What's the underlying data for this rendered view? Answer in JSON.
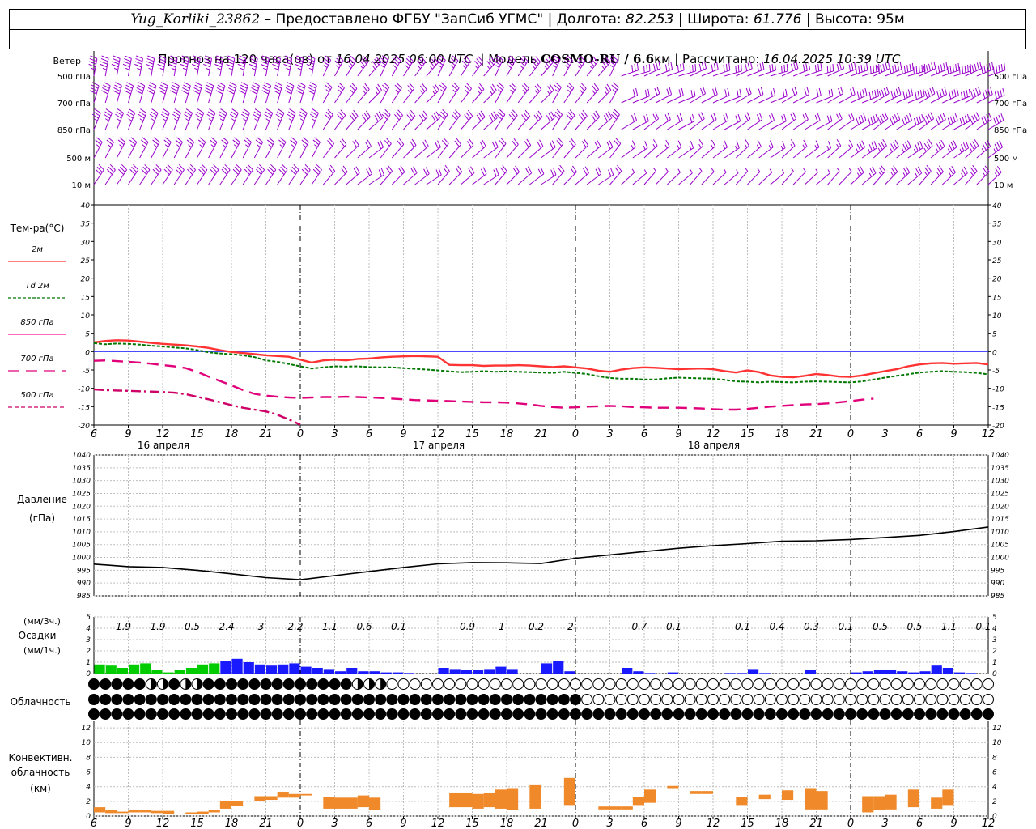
{
  "header": {
    "row1": [
      {
        "text": "Yug_Korliki_23862",
        "style": "italic"
      },
      {
        "text": " – Предоставлено ФГБУ \"ЗапСиб УГМС\" | Долгота: ",
        "style": "normal"
      },
      {
        "text": "82.253",
        "style": "italic"
      },
      {
        "text": " | Широта: ",
        "style": "normal"
      },
      {
        "text": "61.776",
        "style": "italic"
      },
      {
        "text": " | Высота: 95м",
        "style": "normal"
      }
    ],
    "row2": [
      {
        "text": "Прогноз на 120 часа(ов) от ",
        "style": "normal"
      },
      {
        "text": "16.04.2025 06:00 UTC",
        "style": "italic"
      },
      {
        "text": "  | Модель ",
        "style": "normal"
      },
      {
        "text": "COSMO-RU / 6.6",
        "style": "bold"
      },
      {
        "text": "км | Рассчитано: ",
        "style": "normal"
      },
      {
        "text": "16.04.2025 10:39 UTC",
        "style": "italic"
      }
    ]
  },
  "colors": {
    "wind": "#9900cc",
    "t2m": "#ff3333",
    "td2m": "#007700",
    "t850": "#ff1493",
    "t700": "#e0007a",
    "t500": "#cc0066",
    "pressure": "#000000",
    "precip_conv": "#00cc00",
    "precip_strat": "#1a1aff",
    "conv_cloud": "#f0892a",
    "zero_line": "#3333ff"
  },
  "time_axis": {
    "ticks": [
      "6",
      "9",
      "12",
      "15",
      "18",
      "21",
      "0",
      "3",
      "6",
      "9",
      "12",
      "15",
      "18",
      "21",
      "0",
      "3",
      "6",
      "9",
      "12",
      "15",
      "18",
      "21",
      "0",
      "3",
      "6",
      "9",
      "12"
    ],
    "dates": [
      "16 апреля",
      "17 апреля",
      "18 апреля"
    ]
  },
  "wind": {
    "title": "Ветер",
    "levels": [
      "500 гПа",
      "700 гПа",
      "850 гПа",
      "500 м",
      "10  м"
    ]
  },
  "temperature": {
    "title": "Тем-ра(°С)",
    "ylim": [
      -20,
      40
    ],
    "yticks": [
      "40",
      "35",
      "30",
      "25",
      "20",
      "15",
      "10",
      "5",
      "0",
      "-5",
      "-10",
      "-15",
      "-20"
    ],
    "legend": [
      {
        "label": "2м",
        "key": "t2m",
        "dash": ""
      },
      {
        "label": "Td  2м",
        "key": "td2m",
        "dash": "4,2"
      },
      {
        "label": "850 гПа",
        "key": "t850",
        "dash": ""
      },
      {
        "label": "700 гПа",
        "key": "t700",
        "dash": "14,8"
      },
      {
        "label": "500 гПа",
        "key": "t500",
        "dash": "5,3"
      }
    ]
  },
  "pressure": {
    "title1": "Давление",
    "title2": "(гПа)",
    "ylim": [
      985,
      1040
    ],
    "yticks": [
      "1040",
      "1035",
      "1030",
      "1025",
      "1020",
      "1015",
      "1010",
      "1005",
      "1000",
      "995",
      "990",
      "985"
    ]
  },
  "precip": {
    "unit1": "(мм/3ч.)",
    "title": "Осадки",
    "unit2": "(мм/1ч.)",
    "yticks": [
      "5",
      "4",
      "3",
      "2",
      "1",
      "0"
    ],
    "sums": [
      {
        "h": 3,
        "v": "1.9"
      },
      {
        "h": 6,
        "v": "1.9"
      },
      {
        "h": 9,
        "v": "0.5"
      },
      {
        "h": 12,
        "v": "2.4"
      },
      {
        "h": 15,
        "v": "3"
      },
      {
        "h": 18,
        "v": "2.2"
      },
      {
        "h": 21,
        "v": "1.1"
      },
      {
        "h": 24,
        "v": "0.6"
      },
      {
        "h": 27,
        "v": "0.1"
      },
      {
        "h": 33,
        "v": "0.9"
      },
      {
        "h": 36,
        "v": "1"
      },
      {
        "h": 39,
        "v": "0.2"
      },
      {
        "h": 42,
        "v": "2"
      },
      {
        "h": 48,
        "v": "0.7"
      },
      {
        "h": 51,
        "v": "0.1"
      },
      {
        "h": 57,
        "v": "0.1"
      },
      {
        "h": 60,
        "v": "0.4"
      },
      {
        "h": 63,
        "v": "0.3"
      },
      {
        "h": 66,
        "v": "0.1"
      },
      {
        "h": 69,
        "v": "0.5"
      },
      {
        "h": 72,
        "v": "0.5"
      },
      {
        "h": 75,
        "v": "1.1"
      },
      {
        "h": 78,
        "v": "0.1"
      }
    ]
  },
  "clouds": {
    "title": "Облачность"
  },
  "conv": {
    "title1": "Конвективн.",
    "title2": "облачность",
    "title3": "(км)",
    "ylim": [
      0,
      13
    ],
    "yticks": [
      "12",
      "10",
      "8",
      "6",
      "4",
      "2",
      "0"
    ]
  },
  "chart_data": [
    {
      "type": "line",
      "title": "Тем-ра(°С)",
      "x_hours_from_start": [
        0,
        1,
        2,
        3,
        4,
        5,
        6,
        7,
        8,
        9,
        10,
        11,
        12,
        13,
        14,
        15,
        16,
        17,
        18,
        19,
        20,
        21,
        22,
        23,
        24,
        25,
        26,
        27,
        28,
        29,
        30,
        31,
        32,
        33,
        34,
        35,
        36,
        37,
        38,
        39,
        40,
        41,
        42,
        43,
        44,
        45,
        46,
        47,
        48,
        49,
        50,
        51,
        52,
        53,
        54,
        55,
        56,
        57,
        58,
        59,
        60,
        61,
        62,
        63,
        64,
        65,
        66,
        67,
        68,
        69,
        70,
        71,
        72,
        73,
        74,
        75,
        76,
        77,
        78
      ],
      "ylim": [
        -20,
        40
      ],
      "series": [
        {
          "name": "2м",
          "key": "t2m",
          "values": [
            2.5,
            2.9,
            3.1,
            3.0,
            2.7,
            2.4,
            2.1,
            1.9,
            1.7,
            1.4,
            1.0,
            0.4,
            -0.1,
            -0.4,
            -0.7,
            -1.0,
            -1.2,
            -1.4,
            -2.2,
            -3.0,
            -2.4,
            -2.2,
            -2.4,
            -2.0,
            -1.9,
            -1.6,
            -1.4,
            -1.3,
            -1.2,
            -1.3,
            -1.4,
            -3.6,
            -3.7,
            -3.7,
            -3.9,
            -3.8,
            -3.8,
            -3.7,
            -3.8,
            -4.0,
            -4.2,
            -4.0,
            -4.3,
            -4.6,
            -5.2,
            -5.5,
            -4.9,
            -4.5,
            -4.3,
            -4.4,
            -4.6,
            -4.8,
            -4.7,
            -4.6,
            -4.8,
            -5.3,
            -5.7,
            -5.1,
            -5.6,
            -6.5,
            -6.9,
            -7.0,
            -6.6,
            -6.1,
            -6.4,
            -6.8,
            -6.9,
            -6.5,
            -5.9,
            -5.3,
            -4.8,
            -4.0,
            -3.5,
            -3.2,
            -3.1,
            -3.3,
            -3.2,
            -3.1,
            -3.5
          ]
        },
        {
          "name": "Td 2м",
          "key": "td2m",
          "values": [
            2.3,
            2.0,
            2.2,
            2.1,
            1.9,
            1.6,
            1.4,
            1.1,
            0.9,
            0.4,
            -0.2,
            -0.5,
            -0.7,
            -1.0,
            -1.5,
            -2.4,
            -2.8,
            -3.4,
            -4.0,
            -4.6,
            -4.3,
            -4.0,
            -4.1,
            -4.0,
            -4.2,
            -4.3,
            -4.3,
            -4.5,
            -4.7,
            -4.9,
            -5.1,
            -5.4,
            -5.6,
            -5.5,
            -5.3,
            -5.5,
            -5.4,
            -5.5,
            -5.6,
            -5.7,
            -5.8,
            -5.5,
            -5.8,
            -6.1,
            -6.7,
            -7.2,
            -7.4,
            -7.4,
            -7.6,
            -7.6,
            -7.3,
            -7.1,
            -7.2,
            -7.3,
            -7.4,
            -7.7,
            -8.1,
            -8.2,
            -8.4,
            -8.2,
            -8.3,
            -8.4,
            -8.2,
            -8.1,
            -8.2,
            -8.3,
            -8.4,
            -8.1,
            -7.6,
            -7.1,
            -6.6,
            -6.2,
            -5.7,
            -5.5,
            -5.3,
            -5.5,
            -5.6,
            -5.8,
            -6.2
          ]
        },
        {
          "name": "850 гПа",
          "key": "t850",
          "values": [
            null
          ]
        },
        {
          "name": "700 гПа",
          "key": "t700",
          "values": [
            -2.5,
            -2.4,
            -2.6,
            -2.8,
            -3.0,
            -3.3,
            -3.7,
            -4.0,
            -4.5,
            -5.5,
            -6.8,
            -8.0,
            -9.2,
            -10.5,
            -11.5,
            -12.0,
            -12.3,
            -12.5,
            -12.6,
            -12.5,
            -12.4,
            -12.4,
            -12.3,
            -12.4,
            -12.5,
            -12.6,
            -12.8,
            -13.0,
            -13.2,
            -13.3,
            -13.4,
            -13.5,
            -13.6,
            -13.7,
            -13.8,
            -13.8,
            -13.9,
            -14.1,
            -14.4,
            -14.8,
            -15.1,
            -15.3,
            -15.2,
            -15.0,
            -14.9,
            -14.8,
            -14.9,
            -15.1,
            -15.2,
            -15.3,
            -15.3,
            -15.3,
            -15.4,
            -15.5,
            -15.7,
            -15.8,
            -15.8,
            -15.6,
            -15.3,
            -15.0,
            -14.8,
            -14.6,
            -14.4,
            -14.3,
            -14.1,
            -13.8,
            -13.5,
            -13.1,
            -12.8
          ]
        },
        {
          "name": "500 гПа",
          "key": "t500",
          "values": [
            -10.3,
            -10.5,
            -10.6,
            -10.7,
            -10.8,
            -10.9,
            -11.0,
            -11.2,
            -11.6,
            -12.3,
            -13.0,
            -13.8,
            -14.6,
            -15.3,
            -15.8,
            -16.3,
            -17.2,
            -18.5,
            -19.9,
            -21.0
          ]
        }
      ]
    },
    {
      "type": "line",
      "title": "Давление",
      "ylabel": "(гПа)",
      "ylim": [
        985,
        1040
      ],
      "x_hours_from_start": [
        0,
        3,
        6,
        9,
        12,
        15,
        18,
        21,
        24,
        27,
        30,
        33,
        36,
        39,
        42,
        45,
        48,
        51,
        54,
        57,
        60,
        63,
        66,
        69,
        72,
        75,
        78
      ],
      "series": [
        {
          "name": "Давление",
          "values": [
            997.4,
            996.4,
            996.1,
            995.0,
            993.6,
            992.1,
            991.3,
            992.9,
            994.5,
            996.1,
            997.5,
            998.0,
            997.9,
            997.6,
            999.7,
            1001.0,
            1002.3,
            1003.6,
            1004.6,
            1005.4,
            1006.3,
            1006.5,
            1007.0,
            1007.8,
            1008.6,
            1010.1,
            1011.9
          ]
        }
      ]
    },
    {
      "type": "bar",
      "title": "Осадки",
      "ylabel": "(мм/1ч.)",
      "ylim": [
        0,
        5
      ],
      "x_hours_from_start": [
        0,
        1,
        2,
        3,
        4,
        5,
        6,
        7,
        8,
        9,
        10,
        11,
        12,
        13,
        14,
        15,
        16,
        17,
        18,
        19,
        20,
        21,
        22,
        23,
        24,
        25,
        26,
        27,
        28,
        29,
        30,
        31,
        32,
        33,
        34,
        35,
        36,
        37,
        38,
        39,
        40,
        41,
        42,
        43,
        44,
        45,
        46,
        47,
        48,
        49,
        50,
        51,
        52,
        53,
        54,
        55,
        56,
        57,
        58,
        59,
        60,
        61,
        62,
        63,
        64,
        65,
        66,
        67,
        68,
        69,
        70,
        71,
        72,
        73,
        74,
        75,
        76,
        77,
        78
      ],
      "series": [
        {
          "name": "conv",
          "values": [
            0.8,
            0.7,
            0.5,
            0.8,
            0.9,
            0.3,
            0.1,
            0.3,
            0.5,
            0.8,
            0.9,
            0.0,
            0.0,
            0.0,
            0.0,
            0.0,
            0,
            0,
            0,
            0,
            0,
            0,
            0,
            0,
            0,
            0,
            0,
            0,
            0,
            0,
            0,
            0,
            0,
            0,
            0,
            0,
            0,
            0,
            0,
            0,
            0,
            0,
            0,
            0,
            0,
            0,
            0,
            0,
            0,
            0,
            0,
            0,
            0,
            0,
            0,
            0,
            0,
            0,
            0,
            0,
            0,
            0,
            0,
            0,
            0,
            0,
            0,
            0,
            0,
            0,
            0,
            0,
            0,
            0,
            0,
            0,
            0,
            0,
            0
          ]
        },
        {
          "name": "strat",
          "values": [
            0,
            0,
            0,
            0,
            0,
            0,
            0,
            0,
            0,
            0,
            0,
            1.1,
            1.3,
            1.0,
            0.8,
            0.7,
            0.8,
            0.9,
            0.6,
            0.5,
            0.4,
            0.2,
            0.5,
            0.2,
            0.2,
            0.1,
            0.1,
            0.05,
            0,
            0,
            0.5,
            0.4,
            0.3,
            0.3,
            0.4,
            0.6,
            0.4,
            0,
            0,
            0.9,
            1.1,
            0.2,
            0,
            0,
            0,
            0,
            0.5,
            0.2,
            0.05,
            0,
            0.1,
            0,
            0,
            0,
            0,
            0.05,
            0.05,
            0.4,
            0.05,
            0,
            0,
            0,
            0.3,
            0,
            0,
            0,
            0.1,
            0.2,
            0.3,
            0.3,
            0.2,
            0.1,
            0.2,
            0.7,
            0.5,
            0.1,
            0.05,
            0,
            0
          ]
        }
      ]
    },
    {
      "type": "bar",
      "title": "Конвективн. облачность",
      "ylabel": "(км)",
      "ylim": [
        0,
        13
      ],
      "x_hours_from_start": [
        0,
        1,
        2,
        3,
        4,
        5,
        6,
        7,
        8,
        9,
        10,
        11,
        12,
        13,
        14,
        15,
        16,
        17,
        18,
        19,
        20,
        21,
        22,
        23,
        24,
        25,
        26,
        27,
        28,
        29,
        30,
        31,
        32,
        33,
        34,
        35,
        36,
        37,
        38,
        39,
        40,
        41,
        42,
        43,
        44,
        45,
        46,
        47,
        48,
        49,
        50,
        51,
        52,
        53,
        54,
        55,
        56,
        57,
        58,
        59,
        60,
        61,
        62,
        63,
        64,
        65,
        66,
        67,
        68,
        69,
        70,
        71,
        72,
        73,
        74,
        75,
        76,
        77,
        78
      ],
      "series": [
        {
          "name": "base",
          "values": [
            0.5,
            0.4,
            0.4,
            0.5,
            0.5,
            0.4,
            0.3,
            0,
            0.3,
            0.3,
            0.5,
            1.0,
            1.4,
            0,
            2.0,
            2.2,
            2.5,
            2.5,
            2.8,
            0,
            1.0,
            1.0,
            1.0,
            1.2,
            0.8,
            0,
            0,
            0,
            0,
            0,
            0,
            1.2,
            1.2,
            1.0,
            1.2,
            1.0,
            0.8,
            0,
            1.0,
            0,
            0,
            1.5,
            0,
            0,
            0.9,
            0.9,
            0.9,
            1.5,
            1.8,
            0,
            3.8,
            0,
            3.0,
            3.0,
            0,
            0,
            1.5,
            0,
            2.3,
            0,
            2.2,
            0,
            0.9,
            0.9,
            0,
            0,
            0,
            0.5,
            0.8,
            0.9,
            0,
            1.2,
            0,
            1.0,
            1.5,
            0,
            0,
            0,
            0
          ]
        },
        {
          "name": "top",
          "values": [
            1.2,
            0.8,
            0.6,
            0.8,
            0.8,
            0.7,
            0.7,
            0,
            0.5,
            0.6,
            0.8,
            2.0,
            2.0,
            0,
            2.7,
            2.7,
            3.3,
            3.0,
            3.0,
            0,
            2.6,
            2.5,
            2.5,
            2.8,
            2.5,
            0,
            0,
            0,
            0,
            0,
            0,
            3.2,
            3.2,
            3.0,
            3.2,
            3.6,
            3.8,
            0,
            4.2,
            0,
            0,
            5.2,
            0,
            0,
            1.3,
            1.3,
            1.3,
            2.6,
            3.6,
            0,
            4.1,
            0,
            3.4,
            3.4,
            0,
            0,
            2.6,
            0,
            2.9,
            0,
            3.5,
            0,
            3.8,
            3.4,
            0,
            0,
            0,
            2.7,
            2.7,
            2.9,
            0,
            3.6,
            0,
            2.5,
            3.6,
            0,
            0,
            0,
            0
          ]
        }
      ]
    }
  ]
}
